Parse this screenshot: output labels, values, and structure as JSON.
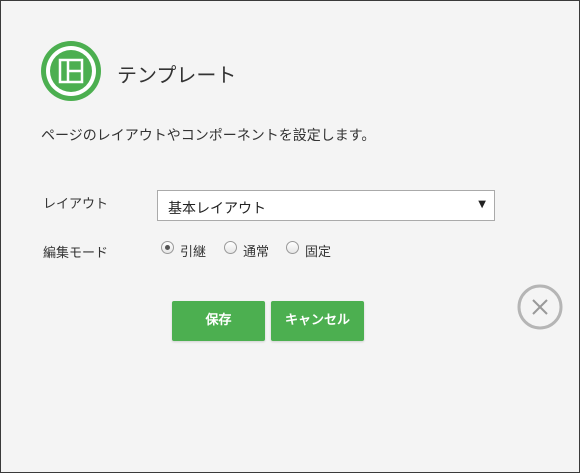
{
  "header": {
    "title": "テンプレート",
    "icon": "layout-template-icon"
  },
  "description": "ページのレイアウトやコンポーネントを設定します。",
  "form": {
    "layout_label": "レイアウト",
    "layout_value": "基本レイアウト",
    "mode_label": "編集モード",
    "mode_options": [
      {
        "label": "引継",
        "checked": true
      },
      {
        "label": "通常",
        "checked": false
      },
      {
        "label": "固定",
        "checked": false
      }
    ]
  },
  "buttons": {
    "save_label": "保存",
    "cancel_label": "キャンセル"
  },
  "close": {
    "icon": "close-icon"
  },
  "colors": {
    "accent": "#4caf50",
    "background": "#f4f4f4"
  }
}
